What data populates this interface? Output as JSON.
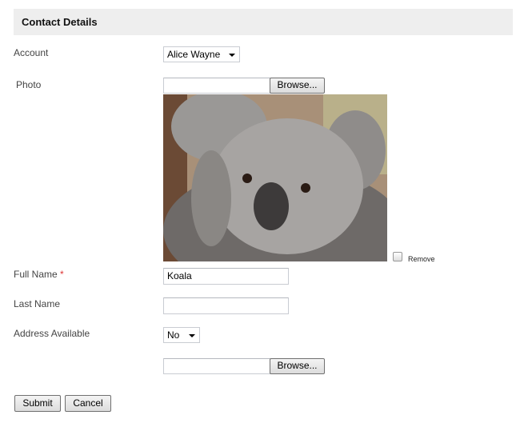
{
  "header": {
    "title": "Contact Details"
  },
  "form": {
    "account": {
      "label": "Account",
      "value": "Alice Wayne"
    },
    "photo": {
      "label": "Photo",
      "browse": "Browse...",
      "remove_label": "Remove",
      "remove_checked": false
    },
    "full_name": {
      "label": "Full Name",
      "required": "*",
      "value": "Koala"
    },
    "last_name": {
      "label": "Last Name",
      "value": ""
    },
    "address_available": {
      "label": "Address Available",
      "value": "No"
    },
    "file2": {
      "browse": "Browse..."
    }
  },
  "actions": {
    "submit": "Submit",
    "cancel": "Cancel"
  }
}
